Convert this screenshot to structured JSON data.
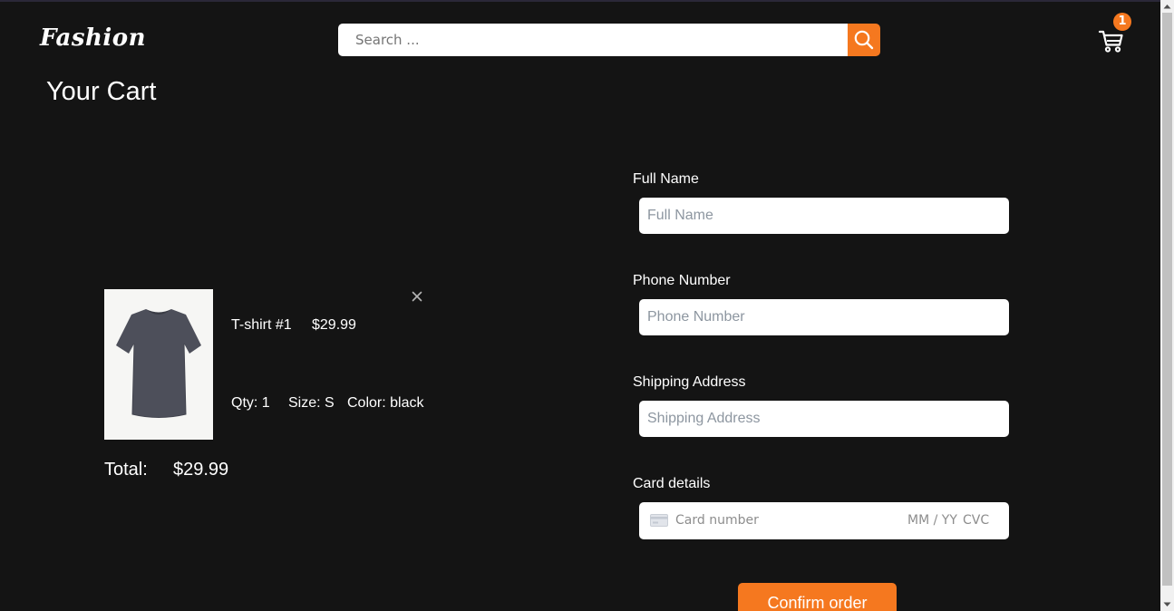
{
  "header": {
    "logo": "Fashion",
    "search_placeholder": "Search ...",
    "cart_count": "1"
  },
  "page_title": "Your Cart",
  "cart": {
    "items": [
      {
        "name": "T-shirt #1",
        "price": "$29.99",
        "qty": "Qty: 1",
        "size": "Size: S",
        "color": "Color: black"
      }
    ],
    "total_label": "Total:",
    "total_value": "$29.99"
  },
  "form": {
    "full_name_label": "Full Name",
    "full_name_placeholder": "Full Name",
    "phone_label": "Phone Number",
    "phone_placeholder": "Phone Number",
    "address_label": "Shipping Address",
    "address_placeholder": "Shipping Address",
    "card_label": "Card details",
    "card_number_placeholder": "Card number",
    "card_expiry_placeholder": "MM / YY",
    "card_cvc_placeholder": "CVC",
    "confirm_label": "Confirm order"
  },
  "colors": {
    "background": "#141414",
    "accent": "#f5781f"
  },
  "icons": {
    "search": "search-icon",
    "cart": "shopping-cart-icon",
    "remove": "close-icon",
    "card": "credit-card-icon"
  }
}
